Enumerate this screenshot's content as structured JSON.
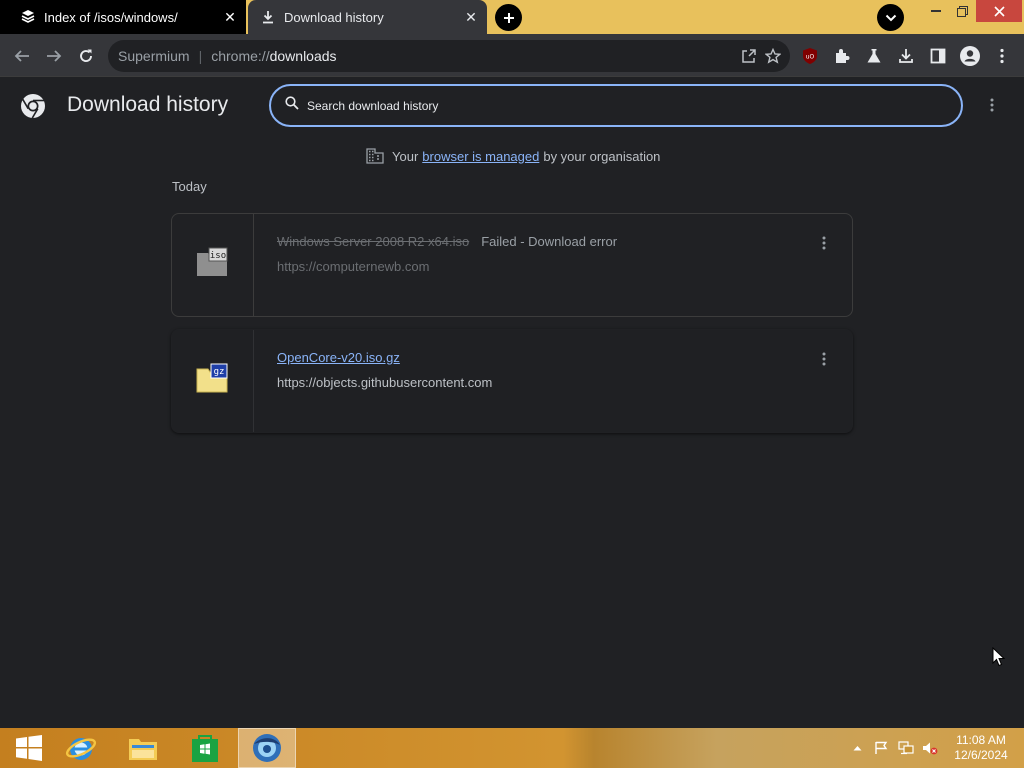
{
  "tabs": [
    {
      "title": "Index of /isos/windows/",
      "icon": "web-page-icon",
      "active": false
    },
    {
      "title": "Download history",
      "icon": "download-icon",
      "active": true
    }
  ],
  "toolbar": {
    "omnibox_chip": "Supermium",
    "omnibox_scheme": "chrome://",
    "omnibox_host": "downloads"
  },
  "page": {
    "title": "Download history",
    "search_placeholder": "Search download history",
    "managed_prefix": "Your",
    "managed_link": "browser is managed",
    "managed_suffix": "by your organisation",
    "section_date": "Today"
  },
  "downloads": [
    {
      "file_name": "Windows Server 2008 R2 x64.iso",
      "status": "Failed - Download error",
      "url": "https://computernewb.com",
      "file_icon": "iso-file-icon",
      "failed": true
    },
    {
      "file_name": "OpenCore-v20.iso.gz",
      "status": "",
      "url": "https://objects.githubusercontent.com",
      "file_icon": "gz-archive-icon",
      "failed": false
    }
  ],
  "taskbar": {
    "clock_time": "11:08 AM",
    "clock_date": "12/6/2024",
    "pinned": [
      "start-button",
      "internet-explorer-icon",
      "file-explorer-icon",
      "store-icon",
      "supermium-icon"
    ]
  },
  "colors": {
    "accent": "#8ab4f8",
    "page_bg": "#202124",
    "toolbar_bg": "#35363a",
    "frame": "#e8c15c",
    "close_button": "#c8473e"
  }
}
